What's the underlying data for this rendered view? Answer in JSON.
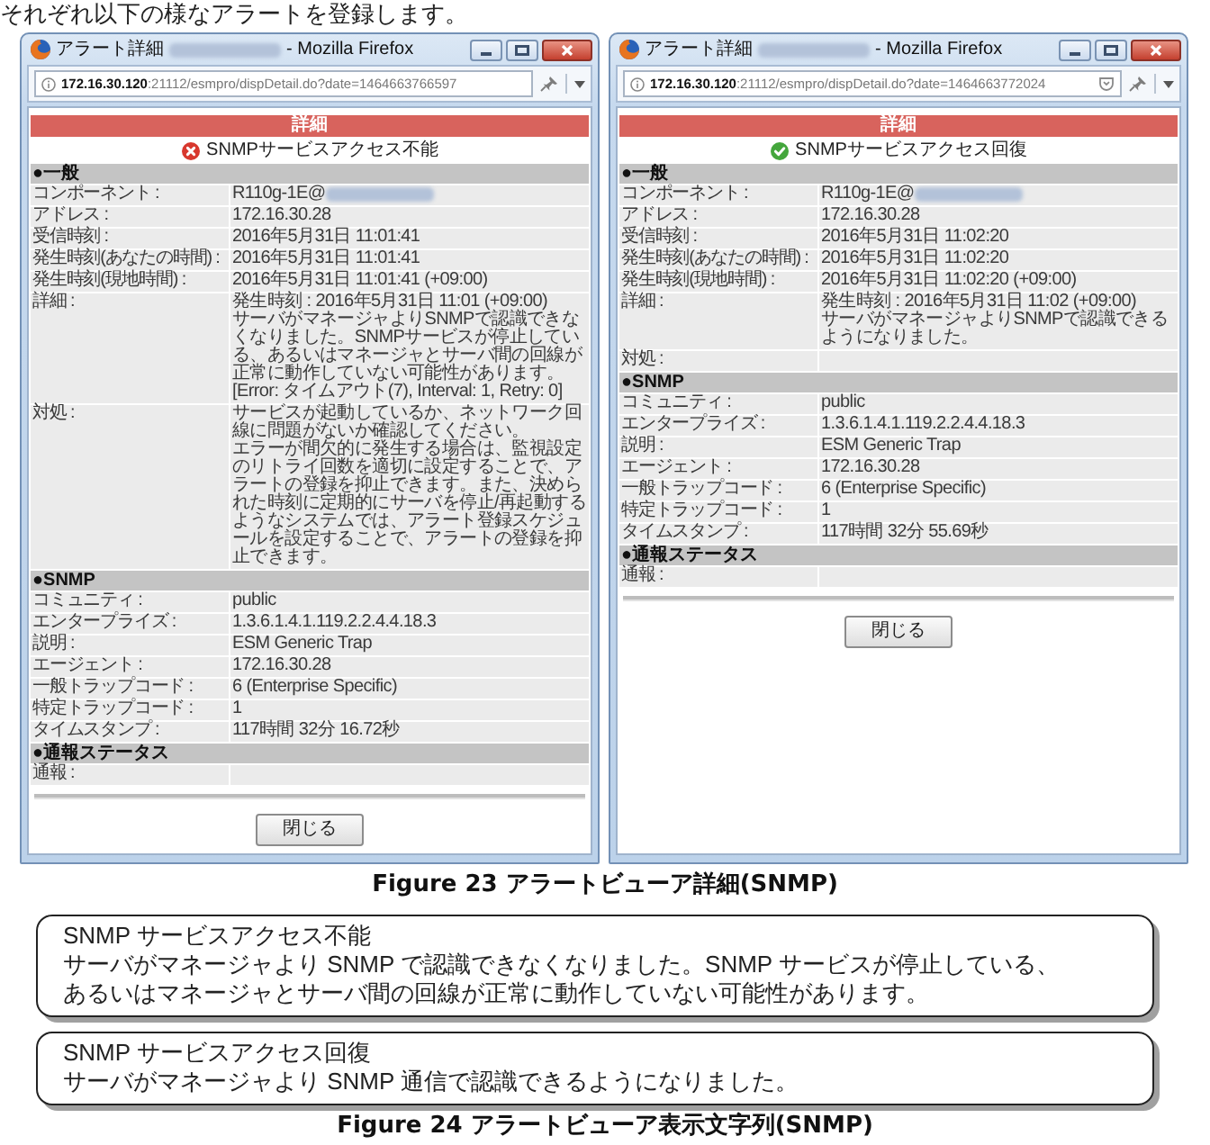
{
  "intro": "それぞれ以下の様なアラートを登録します。",
  "windows": [
    {
      "title": "アラート詳細",
      "title_blurred": true,
      "title_suffix": "- Mozilla Firefox",
      "url": "**172.16.30.120**:21112/esmpro/dispDetail.do?date=1464663766597",
      "shield_icon": false,
      "heading": "詳細",
      "status": {
        "kind": "error",
        "text": "SNMPサービスアクセス不能"
      },
      "sections": [
        {
          "title": "●一般",
          "rows": [
            {
              "label": "コンポーネント :",
              "value": "R110g-1E@",
              "blurred": true
            },
            {
              "label": "アドレス :",
              "value": "172.16.30.28",
              "blurred": false
            },
            {
              "label": "受信時刻 :",
              "value": "2016年5月31日 11:01:41",
              "blurred": false
            },
            {
              "label": "発生時刻(あなたの時間) :",
              "value": "2016年5月31日 11:01:41",
              "blurred": false
            },
            {
              "label": "発生時刻(現地時間) :",
              "value": "2016年5月31日 11:01:41 (+09:00)",
              "blurred": false
            },
            {
              "label": "詳細 :",
              "paragraphs": [
                "発生時刻 : 2016年5月31日 11:01 (+09:00)",
                "サーバがマネージャよりSNMPで認識できなくなりました。SNMPサービスが停止している、あるいはマネージャとサーバ間の回線が正常に動作していない可能性があります。[Error: タイムアウト(7), Interval: 1, Retry: 0]"
              ],
              "blurred": false
            },
            {
              "label": "対処 :",
              "paragraphs": [
                "サービスが起動しているか、ネットワーク回線に問題がないか確認してください。",
                "エラーが間欠的に発生する場合は、監視設定のリトライ回数を適切に設定することで、アラートの登録を抑止できます。また、決められた時刻に定期的にサーバを停止/再起動するようなシステムでは、アラート登録スケジュールを設定することで、アラートの登録を抑止できます。"
              ],
              "blurred": false
            }
          ]
        },
        {
          "title": "●SNMP",
          "rows": [
            {
              "label": "コミュニティ :",
              "value": "public",
              "blurred": false
            },
            {
              "label": "エンタープライズ :",
              "value": "1.3.6.1.4.1.119.2.2.4.4.18.3",
              "blurred": false
            },
            {
              "label": "説明 :",
              "value": "ESM Generic Trap",
              "blurred": false
            },
            {
              "label": "エージェント :",
              "value": "172.16.30.28",
              "blurred": false
            },
            {
              "label": "一般トラップコード :",
              "value": "6 (Enterprise Specific)",
              "blurred": false
            },
            {
              "label": "特定トラップコード :",
              "value": "1",
              "blurred": false
            },
            {
              "label": "タイムスタンプ :",
              "value": "117時間 32分 16.72秒",
              "blurred": false
            }
          ]
        },
        {
          "title": "●通報ステータス",
          "rows": [
            {
              "label": "通報 :",
              "blurred": false
            }
          ]
        }
      ],
      "close_button": "閉じる"
    },
    {
      "title": "アラート詳細",
      "title_blurred": true,
      "title_suffix": "- Mozilla Firefox",
      "url": "**172.16.30.120**:21112/esmpro/dispDetail.do?date=1464663772024",
      "shield_icon": true,
      "heading": "詳細",
      "status": {
        "kind": "ok",
        "text": "SNMPサービスアクセス回復"
      },
      "sections": [
        {
          "title": "●一般",
          "rows": [
            {
              "label": "コンポーネント :",
              "value": "R110g-1E@",
              "blurred": true
            },
            {
              "label": "アドレス :",
              "value": "172.16.30.28",
              "blurred": false
            },
            {
              "label": "受信時刻 :",
              "value": "2016年5月31日 11:02:20",
              "blurred": false
            },
            {
              "label": "発生時刻(あなたの時間) :",
              "value": "2016年5月31日 11:02:20",
              "blurred": false
            },
            {
              "label": "発生時刻(現地時間) :",
              "value": "2016年5月31日 11:02:20 (+09:00)",
              "blurred": false
            },
            {
              "label": "詳細 :",
              "paragraphs": [
                "発生時刻 : 2016年5月31日 11:02 (+09:00)",
                "サーバがマネージャよりSNMPで認識できるようになりました。"
              ],
              "blurred": false
            },
            {
              "label": "対処 :",
              "blurred": false
            }
          ]
        },
        {
          "title": "●SNMP",
          "rows": [
            {
              "label": "コミュニティ :",
              "value": "public",
              "blurred": false
            },
            {
              "label": "エンタープライズ :",
              "value": "1.3.6.1.4.1.119.2.2.4.4.18.3",
              "blurred": false
            },
            {
              "label": "説明 :",
              "value": "ESM Generic Trap",
              "blurred": false
            },
            {
              "label": "エージェント :",
              "value": "172.16.30.28",
              "blurred": false
            },
            {
              "label": "一般トラップコード :",
              "value": "6 (Enterprise Specific)",
              "blurred": false
            },
            {
              "label": "特定トラップコード :",
              "value": "1",
              "blurred": false
            },
            {
              "label": "タイムスタンプ :",
              "value": "117時間 32分 55.69秒",
              "blurred": false
            }
          ]
        },
        {
          "title": "●通報ステータス",
          "rows": [
            {
              "label": "通報 :",
              "blurred": false
            }
          ]
        }
      ],
      "close_button": "閉じる"
    }
  ],
  "figure_caption": "Figure 23 アラートビューア詳細(SNMP)",
  "messages": [
    {
      "title": "SNMP サービスアクセス不能",
      "lines": [
        "サーバがマネージャより SNMP で認識できなくなりました。SNMP サービスが停止している、",
        "あるいはマネージャとサーバ間の回線が正常に動作していない可能性があります。"
      ]
    },
    {
      "title": "SNMP サービスアクセス回復",
      "lines": [
        "サーバがマネージャより SNMP 通信で認識できるようになりました。"
      ]
    }
  ],
  "figure_caption_2": "Figure 24 アラートビューア表示文字列(SNMP)"
}
